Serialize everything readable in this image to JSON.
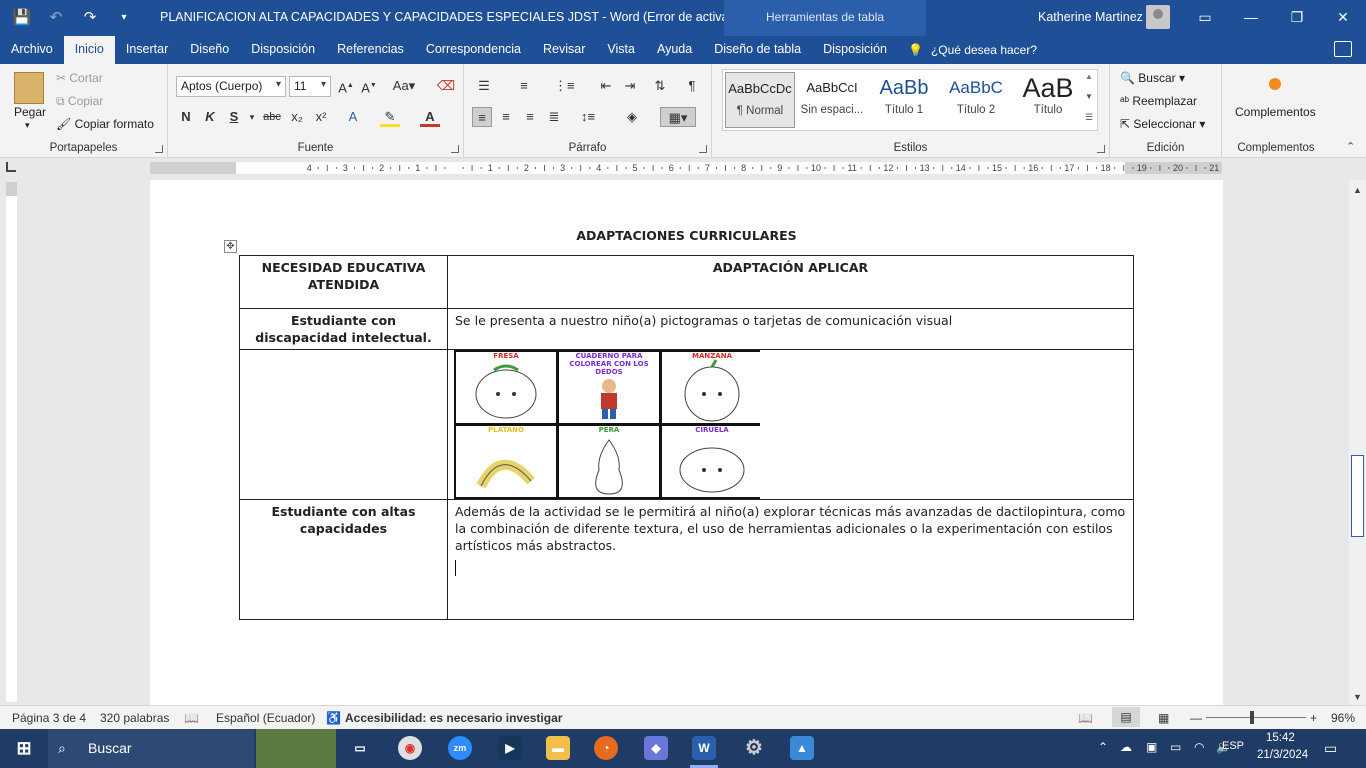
{
  "window": {
    "doc_title": "PLANIFICACION ALTA CAPACIDADES Y CAPACIDADES ESPECIALES JDST  -  Word (Error de activación...",
    "context_title": "Herramientas de tabla",
    "user_name": "Katherine Martinez"
  },
  "tabs": [
    "Archivo",
    "Inicio",
    "Insertar",
    "Diseño",
    "Disposición",
    "Referencias",
    "Correspondencia",
    "Revisar",
    "Vista",
    "Ayuda",
    "Diseño de tabla",
    "Disposición"
  ],
  "tab_active": "Inicio",
  "tell_me": "¿Qué desea hacer?",
  "ribbon": {
    "clipboard": {
      "label": "Portapapeles",
      "paste": "Pegar",
      "cut": "Cortar",
      "copy": "Copiar",
      "format_painter": "Copiar formato"
    },
    "font": {
      "label": "Fuente",
      "font_name": "Aptos (Cuerpo)",
      "font_size": "11"
    },
    "paragraph": {
      "label": "Párrafo"
    },
    "styles": {
      "label": "Estilos",
      "items": [
        {
          "sample": "AaBbCcDc",
          "name": "¶ Normal"
        },
        {
          "sample": "AaBbCcI",
          "name": "Sin espaci..."
        },
        {
          "sample": "AaBb",
          "name": "Título 1"
        },
        {
          "sample": "AaBbC",
          "name": "Título 2"
        },
        {
          "sample": "AaB",
          "name": "Título"
        }
      ]
    },
    "editing": {
      "label": "Edición",
      "find": "Buscar",
      "replace": "Reemplazar",
      "select": "Seleccionar"
    },
    "addins": {
      "label": "Complementos",
      "button": "Complementos"
    }
  },
  "document": {
    "heading": "ADAPTACIONES CURRICULARES",
    "table": {
      "col1_header": "NECESIDAD EDUCATIVA ATENDIDA",
      "col2_header": "ADAPTACIÓN APLICAR",
      "row1_need": "Estudiante con discapacidad intelectual.",
      "row1_adaptation": "Se le presenta a nuestro niño(a) pictogramas o tarjetas de comunicación visual",
      "row3_need": "Estudiante con altas capacidades",
      "row3_adaptation": "Además de la actividad se le permitirá al niño(a) explorar técnicas más avanzadas de dactilopintura, como la combinación de diferente textura, el uso de herramientas adicionales o la experimentación con estilos artísticos más abstractos."
    },
    "picture_captions": [
      "FRESA",
      "CUADERNO PARA COLOREAR CON LOS DEDOS",
      "MANZANA",
      "PLATANO",
      "PERA",
      "CIRUELA"
    ]
  },
  "status": {
    "page": "Página 3 de 4",
    "words": "320 palabras",
    "language": "Español (Ecuador)",
    "accessibility": "Accesibilidad: es necesario investigar",
    "zoom": "96%"
  },
  "taskbar": {
    "search_placeholder": "Buscar",
    "language": "ESP",
    "time": "15:42",
    "date": "21/3/2024"
  },
  "colors": {
    "title_bar": "#1f4f96",
    "ribbon_bg": "#f3f3f3",
    "accent": "#2b5fab"
  }
}
